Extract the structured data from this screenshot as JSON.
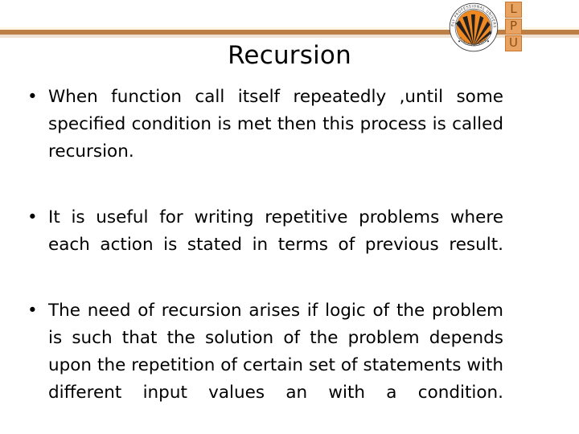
{
  "slide": {
    "title": "Recursion",
    "background_color": "#ffffff",
    "accent_color": "#bc7f45"
  },
  "header": {
    "rule_color": "#bc7f45",
    "rule_highlight_color": "#fdf7e9",
    "rule_shadow_color": "#f0e2d2"
  },
  "logo": {
    "emblem_name": "lpu-sunburst-emblem",
    "ring_text_top": "LOVELY PROFESSIONAL UNIVERSITY",
    "ring_text_bottom": "PUNJAB (INDIA)",
    "emblem_color": "#ef8a22",
    "ray_color": "#231f20",
    "letters": [
      {
        "char": "L"
      },
      {
        "char": "P"
      },
      {
        "char": "U"
      }
    ],
    "letter_box_fill": "#e8a362",
    "letter_box_border": "#c8762c",
    "letter_color": "#8f4f12"
  },
  "content": {
    "bullet_marker": "•",
    "items": [
      {
        "text": "When function call itself repeatedly ,until some specified condition is met then this process is called recursion."
      },
      {
        "text": "It is useful for writing repetitive  problems where each action is stated in terms of previous result."
      },
      {
        "text": "The need of recursion arises if logic of the problem is such that the solution of the problem depends upon the repetition of certain set of statements with different input values an with a condition."
      }
    ]
  }
}
